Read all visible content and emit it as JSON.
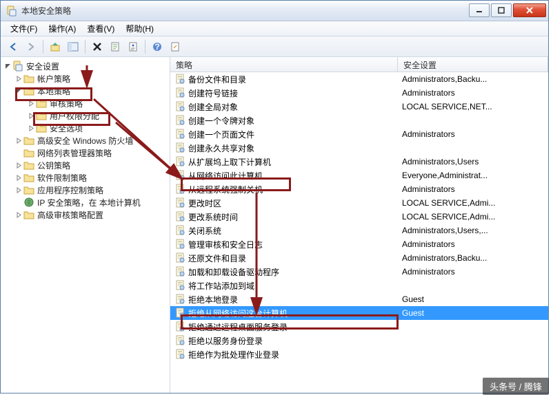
{
  "window": {
    "title": "本地安全策略"
  },
  "menu": {
    "file": "文件(F)",
    "action": "操作(A)",
    "view": "查看(V)",
    "help": "帮助(H)"
  },
  "tree": {
    "root": "安全设置",
    "items": [
      {
        "label": "帐户策略",
        "expand": true,
        "indent": 1
      },
      {
        "label": "本地策略",
        "expand": true,
        "indent": 1,
        "open": true
      },
      {
        "label": "审核策略",
        "expand": true,
        "indent": 2
      },
      {
        "label": "用户权限分配",
        "expand": true,
        "indent": 2
      },
      {
        "label": "安全选项",
        "expand": true,
        "indent": 2
      },
      {
        "label": "高级安全 Windows 防火墙",
        "expand": true,
        "indent": 1
      },
      {
        "label": "网络列表管理器策略",
        "expand": false,
        "indent": 1
      },
      {
        "label": "公钥策略",
        "expand": true,
        "indent": 1
      },
      {
        "label": "软件限制策略",
        "expand": true,
        "indent": 1
      },
      {
        "label": "应用程序控制策略",
        "expand": true,
        "indent": 1
      },
      {
        "label": "IP 安全策略，在 本地计算机",
        "expand": false,
        "indent": 1,
        "globe": true
      },
      {
        "label": "高级审核策略配置",
        "expand": true,
        "indent": 1
      }
    ]
  },
  "columns": {
    "policy": "策略",
    "setting": "安全设置"
  },
  "policies": [
    {
      "name": "备份文件和目录",
      "setting": "Administrators,Backu..."
    },
    {
      "name": "创建符号链接",
      "setting": "Administrators"
    },
    {
      "name": "创建全局对象",
      "setting": "LOCAL SERVICE,NET..."
    },
    {
      "name": "创建一个令牌对象",
      "setting": ""
    },
    {
      "name": "创建一个页面文件",
      "setting": "Administrators"
    },
    {
      "name": "创建永久共享对象",
      "setting": ""
    },
    {
      "name": "从扩展坞上取下计算机",
      "setting": "Administrators,Users"
    },
    {
      "name": "从网络访问此计算机",
      "setting": "Everyone,Administrat..."
    },
    {
      "name": "从远程系统强制关机",
      "setting": "Administrators"
    },
    {
      "name": "更改时区",
      "setting": "LOCAL SERVICE,Admi..."
    },
    {
      "name": "更改系统时间",
      "setting": "LOCAL SERVICE,Admi..."
    },
    {
      "name": "关闭系统",
      "setting": "Administrators,Users,..."
    },
    {
      "name": "管理审核和安全日志",
      "setting": "Administrators"
    },
    {
      "name": "还原文件和目录",
      "setting": "Administrators,Backu..."
    },
    {
      "name": "加载和卸载设备驱动程序",
      "setting": "Administrators"
    },
    {
      "name": "将工作站添加到域",
      "setting": ""
    },
    {
      "name": "拒绝本地登录",
      "setting": "Guest"
    },
    {
      "name": "拒绝从网络访问这台计算机",
      "setting": "Guest",
      "selected": true
    },
    {
      "name": "拒绝通过远程桌面服务登录",
      "setting": ""
    },
    {
      "name": "拒绝以服务身份登录",
      "setting": ""
    },
    {
      "name": "拒绝作为批处理作业登录",
      "setting": ""
    }
  ],
  "watermark": "头条号 / 腾锋"
}
